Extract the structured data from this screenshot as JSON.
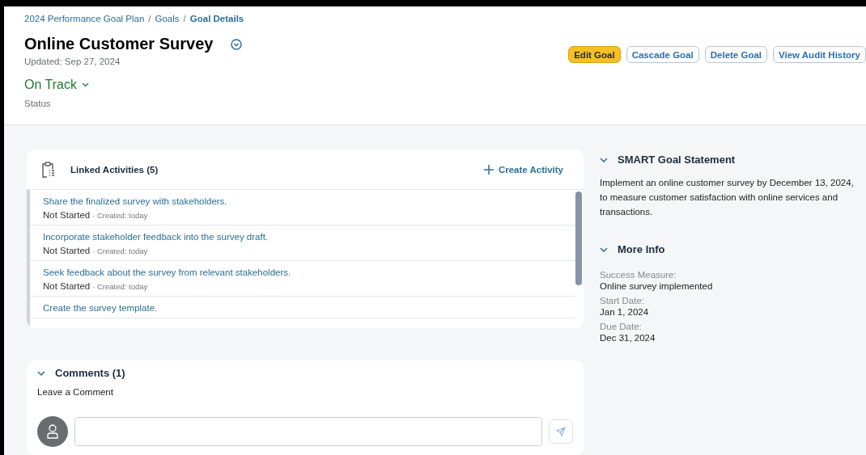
{
  "breadcrumb": [
    {
      "label": "2024 Performance Goal Plan",
      "current": false
    },
    {
      "label": "Goals",
      "current": false
    },
    {
      "label": "Goal Details",
      "current": true
    }
  ],
  "breadcrumb_separator": "/",
  "title": "Online Customer Survey",
  "updated": "Updated: Sep 27, 2024",
  "status": {
    "value": "On Track",
    "label": "Status"
  },
  "actions": [
    {
      "label": "Edit Goal",
      "kind": "primary"
    },
    {
      "label": "Cascade Goal",
      "kind": "secondary"
    },
    {
      "label": "Delete Goal",
      "kind": "secondary"
    },
    {
      "label": "View Audit History",
      "kind": "secondary"
    }
  ],
  "activities": {
    "title": "Linked Activities (5)",
    "create": "Create Activity",
    "items": [
      {
        "title": "Share the finalized survey with stakeholders.",
        "status": "Not Started",
        "created": "· Created: today"
      },
      {
        "title": "Incorporate stakeholder feedback into the survey draft.",
        "status": "Not Started",
        "created": "· Created: today"
      },
      {
        "title": "Seek feedback about the survey from relevant stakeholders.",
        "status": "Not Started",
        "created": "· Created: today"
      },
      {
        "title": "Create the survey template."
      }
    ]
  },
  "smart_goal": {
    "title": "SMART Goal Statement",
    "expanded": true,
    "text": "Implement an online customer survey by December 13, 2024, to measure customer satisfaction with online services and transactions."
  },
  "more_info": {
    "title": "More Info",
    "expanded": true,
    "fields": [
      {
        "label": "Success Measure:",
        "value": "Online survey implemented"
      },
      {
        "label": "Start Date:",
        "value": "Jan 1, 2024"
      },
      {
        "label": "Due Date:",
        "value": "Dec 31, 2024"
      }
    ]
  },
  "comments": {
    "title": "Comments (1)",
    "expanded": true,
    "prompt": "Leave a Comment"
  }
}
